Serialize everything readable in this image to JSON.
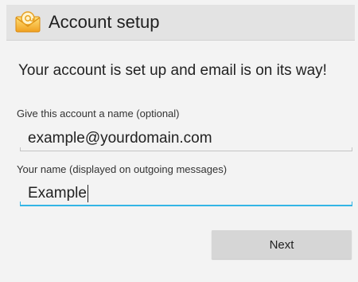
{
  "action_bar": {
    "icon": "email-app-icon",
    "title": "Account setup"
  },
  "content": {
    "headline": "Your account is set up and email is on its way!",
    "account_name": {
      "label": "Give this account a name (optional)",
      "value": "example@yourdomain.com"
    },
    "your_name": {
      "label": "Your name (displayed on outgoing messages)",
      "value": "Example",
      "focused": true
    }
  },
  "buttons": {
    "next_label": "Next"
  },
  "colors": {
    "action_bar_bg": "#e3e3e3",
    "focus_accent": "#33b5e5",
    "button_bg": "#d6d6d6",
    "screen_bg": "#f3f3f3"
  }
}
